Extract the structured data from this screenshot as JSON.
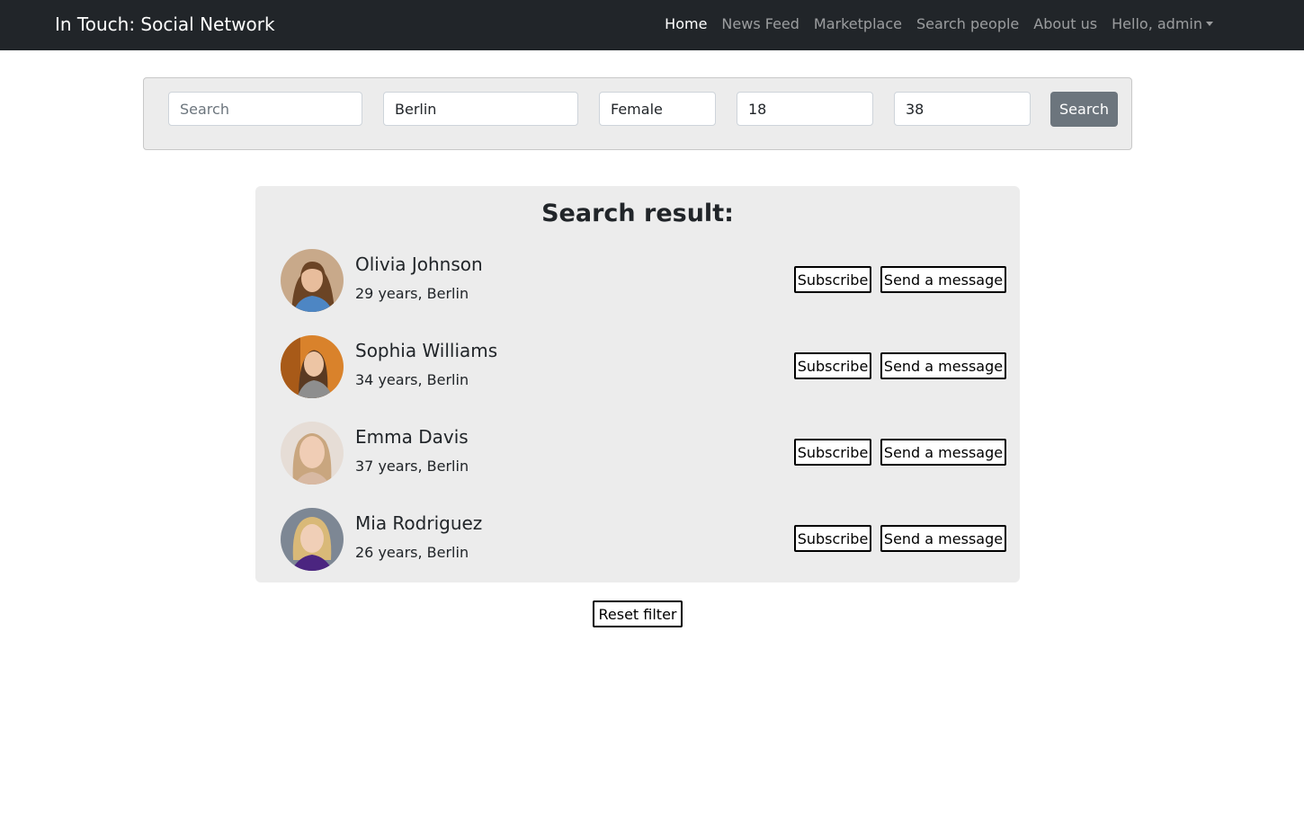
{
  "navbar": {
    "brand": "In Touch: Social Network",
    "links": [
      {
        "label": "Home",
        "active": true
      },
      {
        "label": "News Feed"
      },
      {
        "label": "Marketplace"
      },
      {
        "label": "Search people"
      },
      {
        "label": "About us"
      }
    ],
    "user_menu": "Hello, admin"
  },
  "filter": {
    "search": {
      "placeholder": "Search",
      "value": ""
    },
    "city": "Berlin",
    "gender": "Female",
    "age_from": "18",
    "age_to": "38",
    "submit_label": "Search"
  },
  "results": {
    "title": "Search result:",
    "subscribe_label": "Subscribe",
    "message_label": "Send a message",
    "people": [
      {
        "name": "Olivia Johnson",
        "info": "29 years, Berlin"
      },
      {
        "name": "Sophia Williams",
        "info": "34 years, Berlin"
      },
      {
        "name": "Emma Davis",
        "info": "37 years, Berlin"
      },
      {
        "name": "Mia Rodriguez",
        "info": "26 years, Berlin"
      }
    ]
  },
  "reset_label": "Reset filter",
  "colors": {
    "navbar_bg": "#212529",
    "panel_bg": "#ececec",
    "search_button_bg": "#6c757d"
  }
}
